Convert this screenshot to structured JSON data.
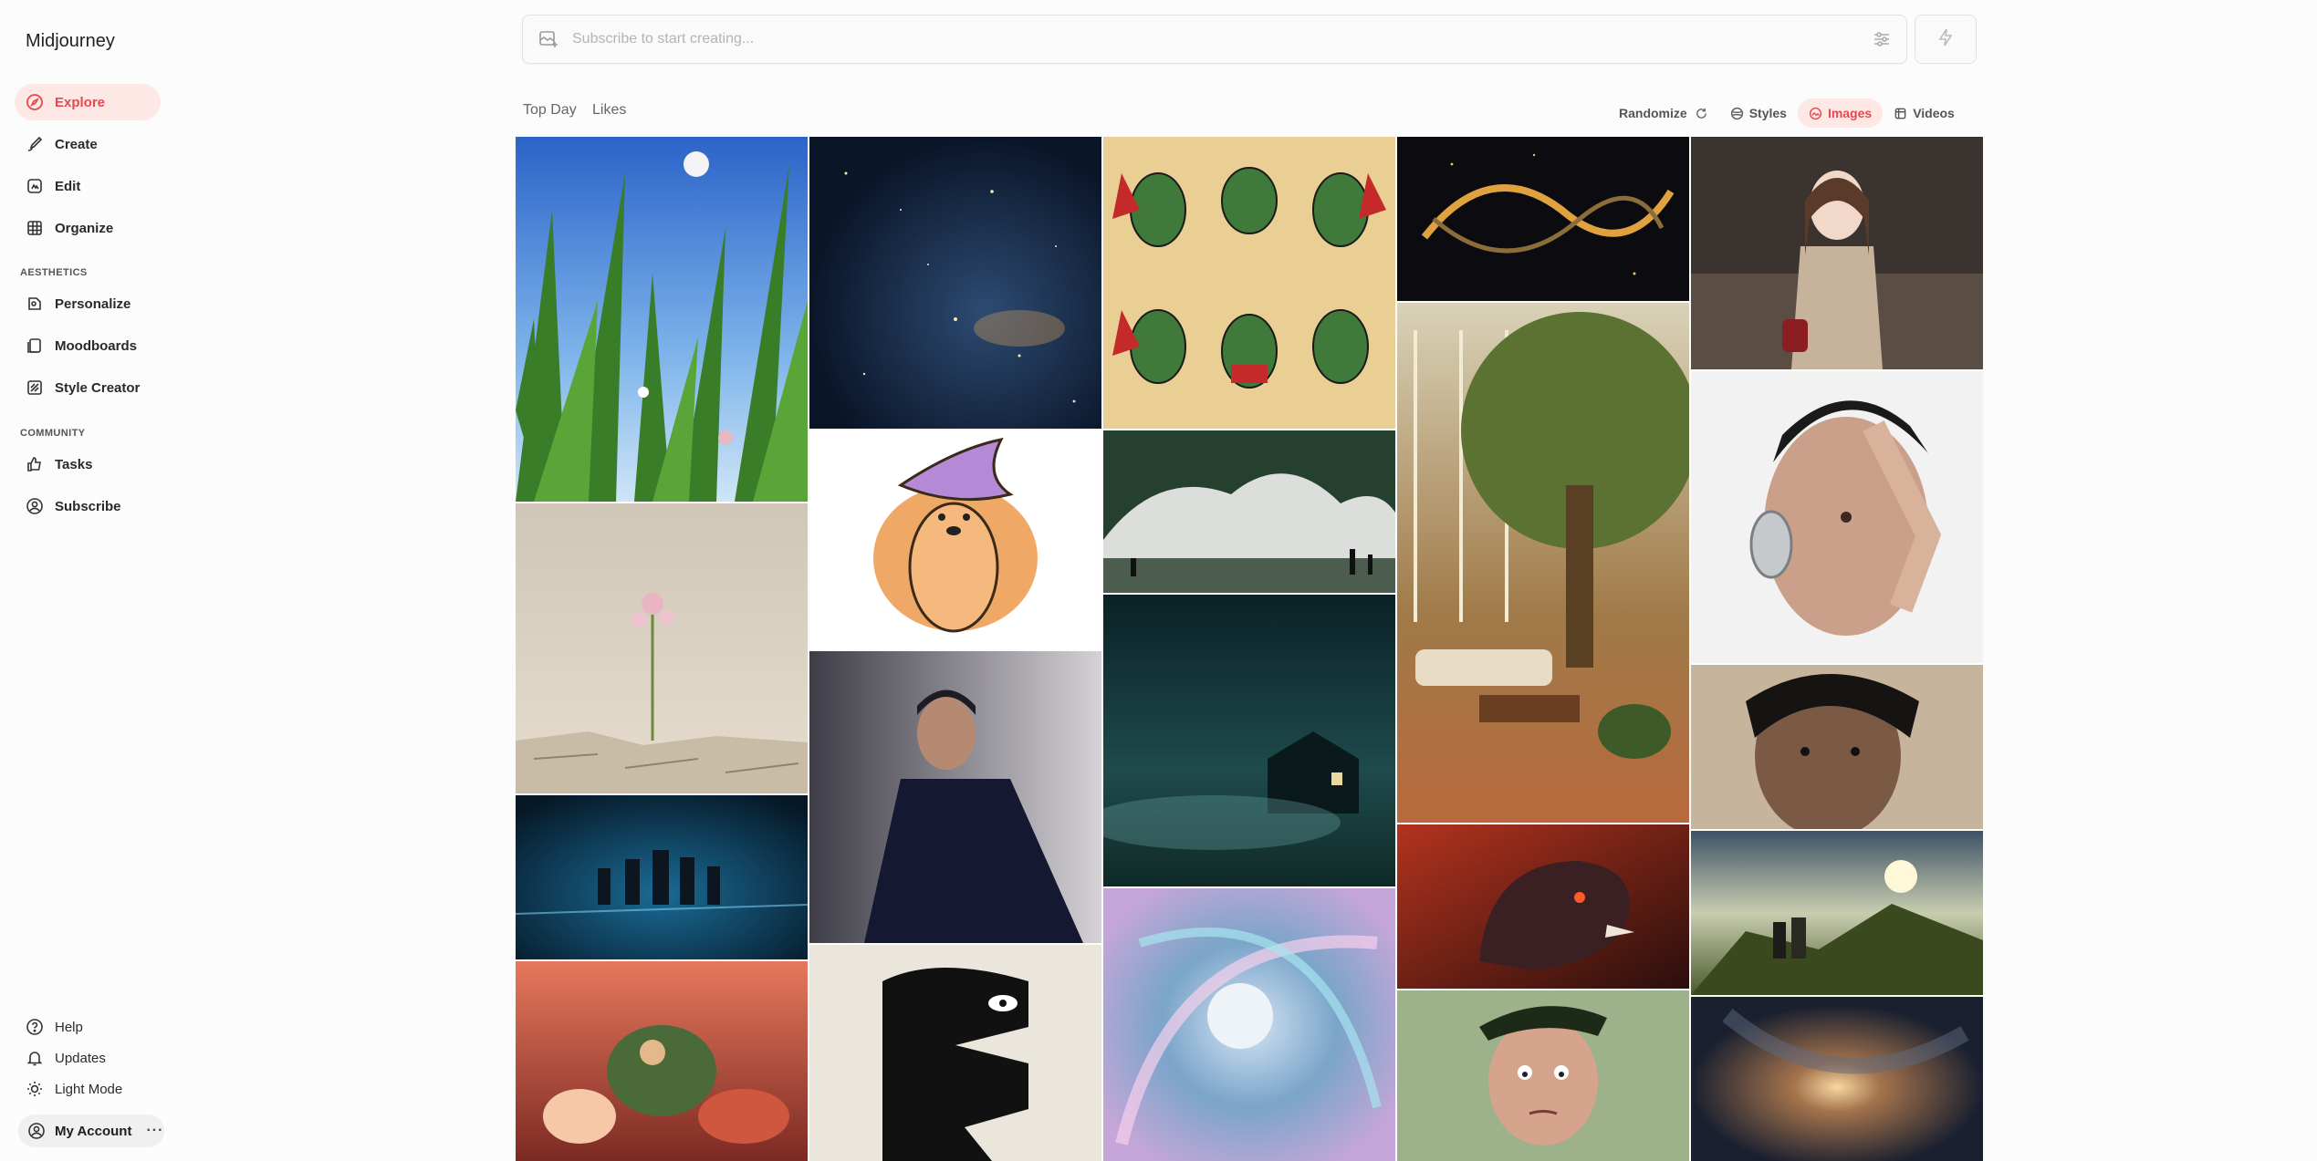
{
  "app": {
    "name": "Midjourney"
  },
  "sidebar": {
    "items": [
      {
        "label": "Explore",
        "icon": "compass-icon"
      },
      {
        "label": "Create",
        "icon": "brush-icon"
      },
      {
        "label": "Edit",
        "icon": "edit-image-icon"
      },
      {
        "label": "Organize",
        "icon": "grid-icon"
      }
    ],
    "aesthetics_label": "AESTHETICS",
    "aesthetics_items": [
      {
        "label": "Personalize",
        "icon": "personalize-icon"
      },
      {
        "label": "Moodboards",
        "icon": "moodboard-icon"
      },
      {
        "label": "Style Creator",
        "icon": "style-creator-icon"
      }
    ],
    "community_label": "COMMUNITY",
    "community_items": [
      {
        "label": "Tasks",
        "icon": "thumbs-up-icon"
      },
      {
        "label": "Subscribe",
        "icon": "user-circle-icon"
      }
    ],
    "footer_items": [
      {
        "label": "Help",
        "icon": "help-icon"
      },
      {
        "label": "Updates",
        "icon": "bell-icon"
      },
      {
        "label": "Light Mode",
        "icon": "sun-icon"
      }
    ],
    "account_label": "My Account",
    "account_more": "···"
  },
  "prompt": {
    "placeholder": "Subscribe to start creating..."
  },
  "tabs": {
    "top_day": "Top Day",
    "likes": "Likes"
  },
  "tools": {
    "randomize": "Randomize",
    "styles": "Styles",
    "images": "Images",
    "videos": "Videos"
  },
  "colors": {
    "accent": "#e5484d",
    "accent_bg": "#fde8e6"
  },
  "gallery": [
    {
      "col": 0,
      "items": [
        "grass-sky",
        "wildflower-cracked-earth",
        "chess-pieces",
        "fantasy-forest-scene"
      ]
    },
    {
      "col": 1,
      "items": [
        "starry-galaxy",
        "wizard-bear-cartoon",
        "dark-caped-man",
        "black-abstract-creature"
      ]
    },
    {
      "col": 2,
      "items": [
        "goblin-sprites",
        "tidal-wave",
        "foggy-cabin-night",
        "cosmic-swirl-moon"
      ]
    },
    {
      "col": 3,
      "items": [
        "golden-ribbon-dragon",
        "greenhouse-tree-lounge",
        "lava-dinosaur",
        "claymation-character"
      ]
    },
    {
      "col": 4,
      "items": [
        "woman-in-store",
        "woman-silver-earring",
        "warrior-closeup",
        "cloaked-figures-hill",
        "nebula-explosion"
      ]
    }
  ]
}
